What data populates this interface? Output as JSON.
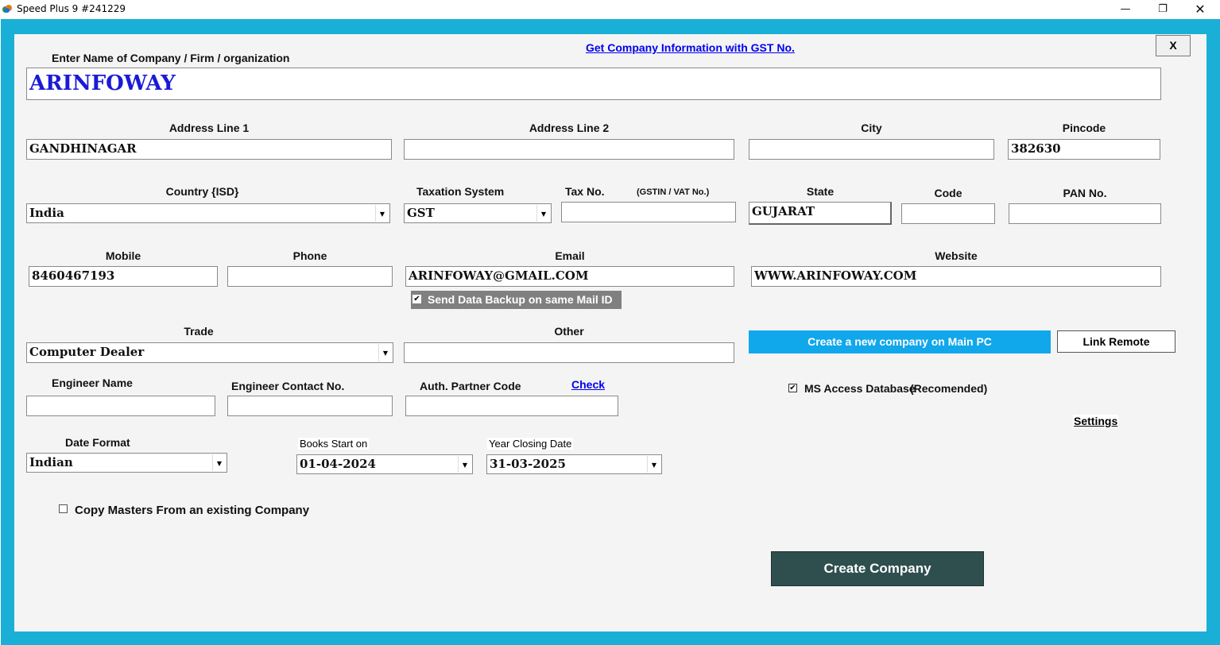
{
  "window": {
    "title": "Speed Plus 9 #241229",
    "close_x": "X"
  },
  "company": {
    "label": "Enter Name of Company / Firm / organization",
    "value": "ARINFOWAY",
    "gst_link": "Get Company Information with GST No."
  },
  "address": {
    "line1_label": "Address Line 1",
    "line1_value": "GANDHINAGAR",
    "line2_label": "Address Line 2",
    "line2_value": "",
    "city_label": "City",
    "city_value": "",
    "pincode_label": "Pincode",
    "pincode_value": "382630"
  },
  "tax": {
    "country_label": "Country {ISD}",
    "country_value": "India",
    "taxation_label": "Taxation System",
    "taxation_value": "GST",
    "taxno_label": "Tax No.",
    "taxno_hint": "(GSTIN / VAT No.)",
    "taxno_value": "",
    "state_label": "State",
    "state_value": "GUJARAT",
    "code_label": "Code",
    "code_value": "",
    "pan_label": "PAN No.",
    "pan_value": ""
  },
  "contact": {
    "mobile_label": "Mobile",
    "mobile_value": "8460467193",
    "phone_label": "Phone",
    "phone_value": "",
    "email_label": "Email",
    "email_value": "ARINFOWAY@GMAIL.COM",
    "website_label": "Website",
    "website_value": "WWW.ARINFOWAY.COM",
    "backup_label": "Send Data Backup on same Mail ID",
    "backup_checked": true
  },
  "trade": {
    "trade_label": "Trade",
    "trade_value": "Computer Dealer",
    "other_label": "Other",
    "other_value": ""
  },
  "engineer": {
    "name_label": "Engineer Name",
    "name_value": "",
    "contact_label": "Engineer Contact No.",
    "contact_value": "",
    "partner_label": "Auth. Partner Code",
    "partner_value": "",
    "check_link": "Check"
  },
  "dates": {
    "format_label": "Date Format",
    "format_value": "Indian",
    "books_label": "Books Start on",
    "books_value": "01-04-2024",
    "closing_label": "Year Closing Date",
    "closing_value": "31-03-2025"
  },
  "options": {
    "copy_masters_label": "Copy Masters From an existing Company",
    "copy_masters_checked": false,
    "create_main_pc": "Create a new company on Main PC",
    "link_remote": "Link Remote",
    "ms_access_label": "MS Access Database",
    "ms_access_note": "(Recomended)",
    "ms_access_checked": true,
    "settings_link": "Settings",
    "create_company": "Create Company"
  },
  "colors": {
    "frame": "#1aafd6",
    "panel": "#f4f4f4",
    "primary_button": "#11a7eb",
    "create_button": "#2f4f4f",
    "company_name": "#1a1ad6",
    "link": "#0000ee"
  }
}
